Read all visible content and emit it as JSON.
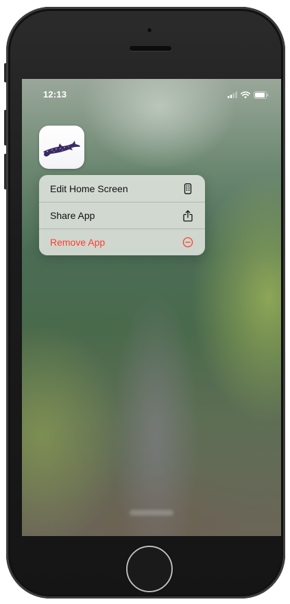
{
  "status_bar": {
    "time": "12:13"
  },
  "app": {
    "icon": "whale-shark-app-icon"
  },
  "context_menu": {
    "items": [
      {
        "label": "Edit Home Screen",
        "icon": "phone-apps-icon",
        "destructive": false
      },
      {
        "label": "Share App",
        "icon": "share-icon",
        "destructive": false
      },
      {
        "label": "Remove App",
        "icon": "minus-circle-icon",
        "destructive": true
      }
    ]
  },
  "colors": {
    "destructive": "#ff3b30",
    "menu_text": "#111111",
    "app_icon_shark": "#3b2a63"
  }
}
